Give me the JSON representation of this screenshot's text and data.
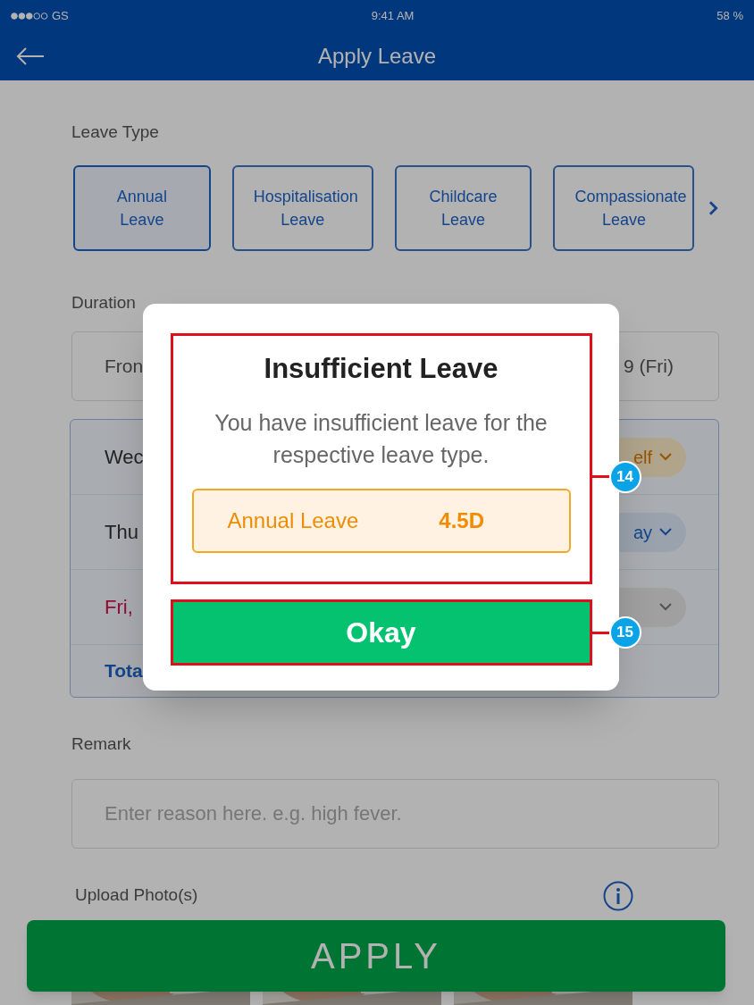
{
  "status_bar": {
    "carrier": "GS",
    "time": "9:41 AM",
    "battery": "58 %"
  },
  "header": {
    "title": "Apply Leave"
  },
  "leave_type": {
    "label": "Leave Type",
    "options": [
      {
        "label": "Annual Leave",
        "selected": true
      },
      {
        "label": "Hospitalisation Leave",
        "selected": false
      },
      {
        "label": "Childcare Leave",
        "selected": false
      },
      {
        "label": "Compassionate Leave",
        "selected": false
      }
    ]
  },
  "duration": {
    "label": "Duration",
    "from_start": "Fron",
    "from_end": "9 (Fri)",
    "days": [
      {
        "label": "Wec",
        "highlighted": false,
        "option": "elf",
        "kind": "half"
      },
      {
        "label": "Thu",
        "highlighted": false,
        "option": "ay",
        "kind": "full"
      },
      {
        "label": "Fri,",
        "highlighted": true,
        "kind": "none"
      }
    ],
    "total": "Tota"
  },
  "remark": {
    "label": "Remark",
    "placeholder": "Enter reason here. e.g. high fever."
  },
  "upload": {
    "label": "Upload Photo(s)"
  },
  "apply_button": "APPLY",
  "dialog": {
    "title": "Insufficient Leave",
    "message": "You have insufficient leave for the respective leave type.",
    "balance": {
      "type": "Annual Leave",
      "value": "4.5D"
    },
    "button": "Okay"
  },
  "annotations": [
    {
      "label": "14"
    },
    {
      "label": "15"
    }
  ]
}
